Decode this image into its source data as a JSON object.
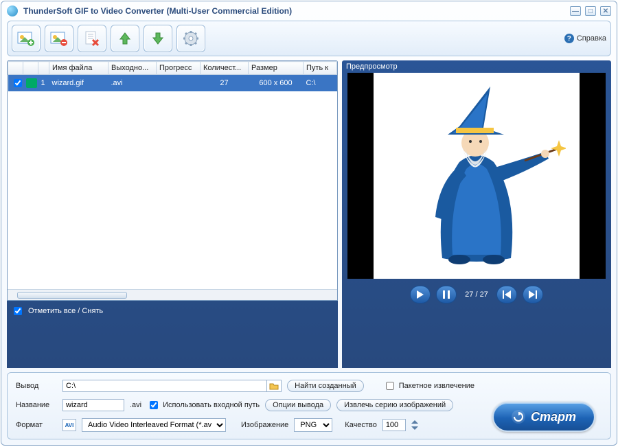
{
  "title": "ThunderSoft GIF to Video Converter (Multi-User Commercial Edition)",
  "help_label": "Справка",
  "table": {
    "headers": [
      "",
      "",
      "",
      "Имя файла",
      "Выходно...",
      "Прогресс",
      "Количест...",
      "Размер",
      "Путь к"
    ],
    "row": {
      "index": "1",
      "filename": "wizard.gif",
      "output": ".avi",
      "progress": "",
      "count": "27",
      "size": "600 x 600",
      "path": "C:\\"
    }
  },
  "select_all": "Отметить все / Снять",
  "preview_label": "Предпросмотр",
  "player": {
    "counter": "27 / 27"
  },
  "form": {
    "output_label": "Вывод",
    "output_value": "C:\\",
    "find_created": "Найти созданный",
    "batch_extract": "Пакетное извлечение",
    "name_label": "Название",
    "name_value": "wizard",
    "name_ext": ".avi",
    "use_input_path": "Использовать входной путь",
    "output_options": "Опции вывода",
    "extract_series": "Извлечь серию изображений",
    "format_label": "Формат",
    "format_value": "Audio Video Interleaved Format (*.avi)",
    "image_label": "Изображение",
    "image_value": "PNG",
    "quality_label": "Качество",
    "quality_value": "100"
  },
  "start_label": "Старт"
}
